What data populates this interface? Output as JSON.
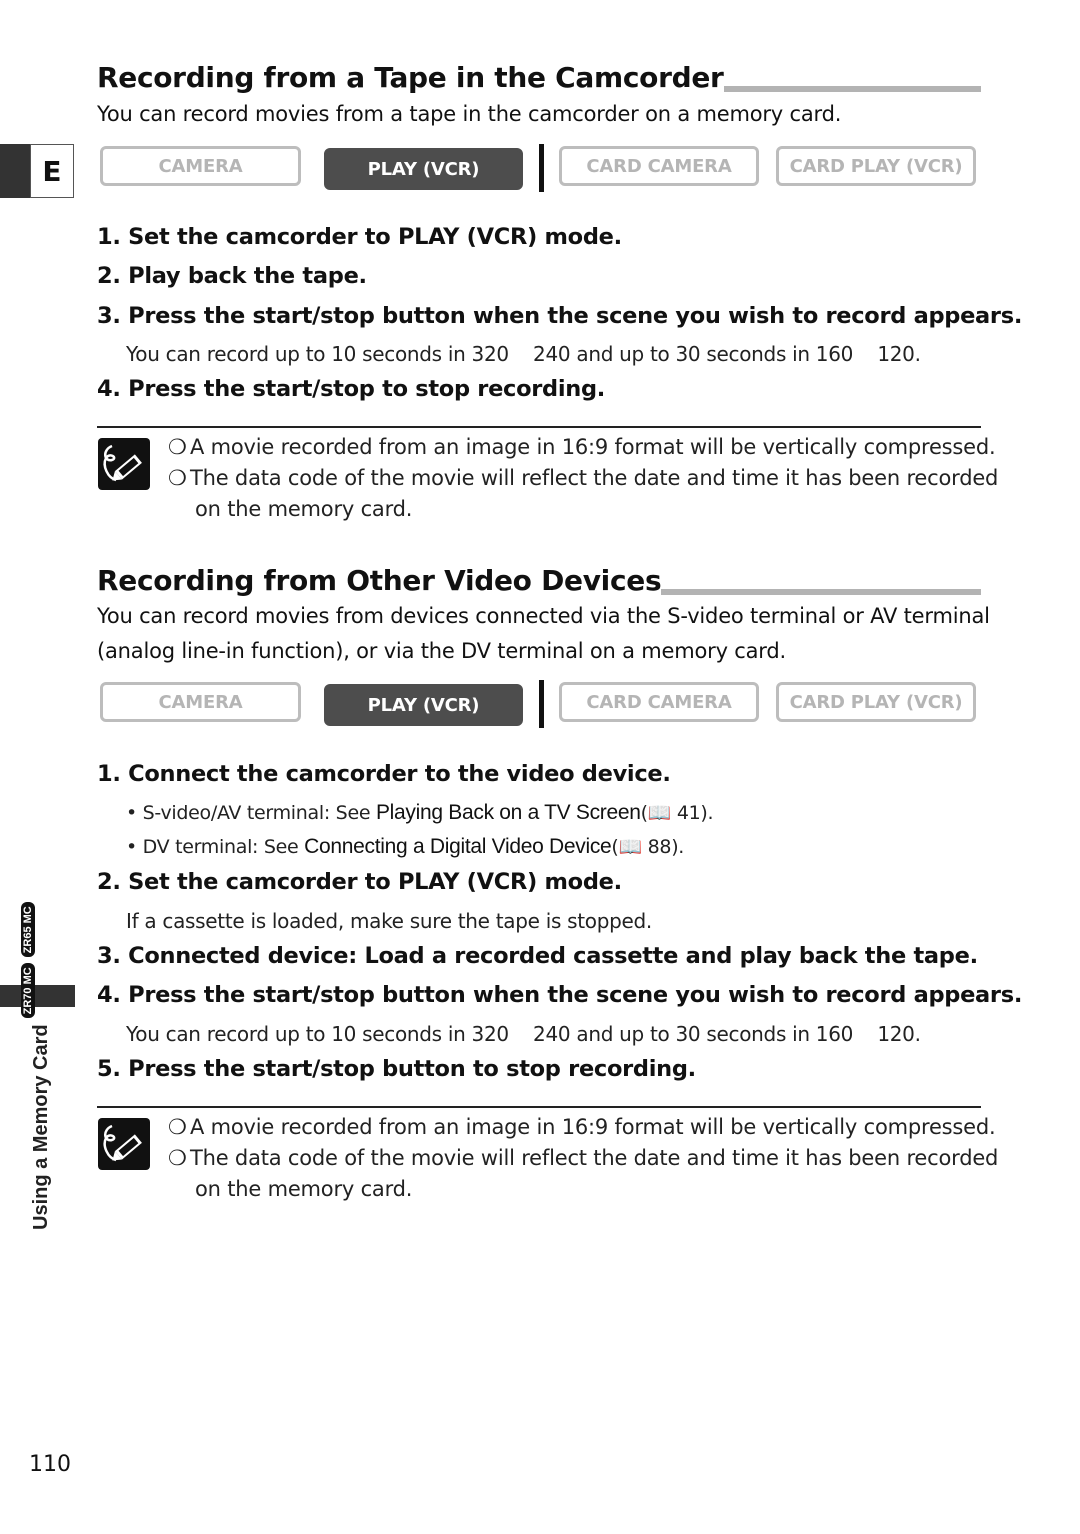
{
  "side_tab": {
    "language_letter": "E"
  },
  "sidebar": {
    "chapter": "Using a Memory Card",
    "model_badges": [
      "ZR70 MC",
      "ZR65 MC"
    ]
  },
  "section1": {
    "title": "Recording from a Tape in the Camcorder",
    "intro": "You can record movies from a tape in the camcorder on a memory card.",
    "modes": [
      {
        "label": "CAMERA",
        "active": false
      },
      {
        "label": "PLAY (VCR)",
        "active": true
      },
      {
        "label": "CARD CAMERA",
        "active": false
      },
      {
        "label": "CARD PLAY (VCR)",
        "active": false
      }
    ],
    "steps": [
      "1. Set the camcorder to PLAY (VCR) mode.",
      "2. Play back the tape.",
      "3. Press the start/stop button when the scene you wish to record appears.",
      "4. Press the start/stop to stop recording."
    ],
    "step3_detail": "You can record up to 10 seconds in 320    240 and up to 30 seconds in 160    120.",
    "notes": {
      "icon": "pencil-note-icon",
      "bullet": "❍",
      "line1": "A movie recorded from an image in 16:9 format will be vertically compressed.",
      "line2": "The data code of the movie will reflect the date and time it has been recorded",
      "line2_cont": "on the memory card."
    }
  },
  "section2": {
    "title": "Recording from Other Video Devices",
    "intro_line1": "You can record movies from devices connected via the S-video terminal or AV terminal",
    "intro_line2": "(analog line-in function), or via the DV terminal on a memory card.",
    "modes": [
      {
        "label": "CAMERA",
        "active": false
      },
      {
        "label": "PLAY (VCR)",
        "active": true
      },
      {
        "label": "CARD CAMERA",
        "active": false
      },
      {
        "label": "CARD PLAY (VCR)",
        "active": false
      }
    ],
    "steps": [
      "1. Connect the camcorder to the video device.",
      "2. Set the camcorder to PLAY (VCR) mode.",
      "3. Connected device: Load a recorded cassette and play back the tape.",
      "4. Press the start/stop button when the scene you wish to record appears.",
      "5. Press the start/stop button to stop recording."
    ],
    "step1_bullets": [
      {
        "prefix": "• S-video/AV terminal: See ",
        "ref": "Playing Back on a TV Screen",
        "page": "(📖 41)."
      },
      {
        "prefix": "• DV terminal: See ",
        "ref": "Connecting a Digital Video Device",
        "page": "(📖 88)."
      }
    ],
    "step2_detail": "If a cassette is loaded, make sure the tape is stopped.",
    "step4_detail": "You can record up to 10 seconds in 320    240 and up to 30 seconds in 160    120.",
    "notes": {
      "icon": "pencil-note-icon",
      "bullet": "❍",
      "line1": "A movie recorded from an image in 16:9 format will be vertically compressed.",
      "line2": "The data code of the movie will reflect the date and time it has been recorded",
      "line2_cont": "on the memory card."
    }
  },
  "footer": {
    "page_number": "110"
  }
}
